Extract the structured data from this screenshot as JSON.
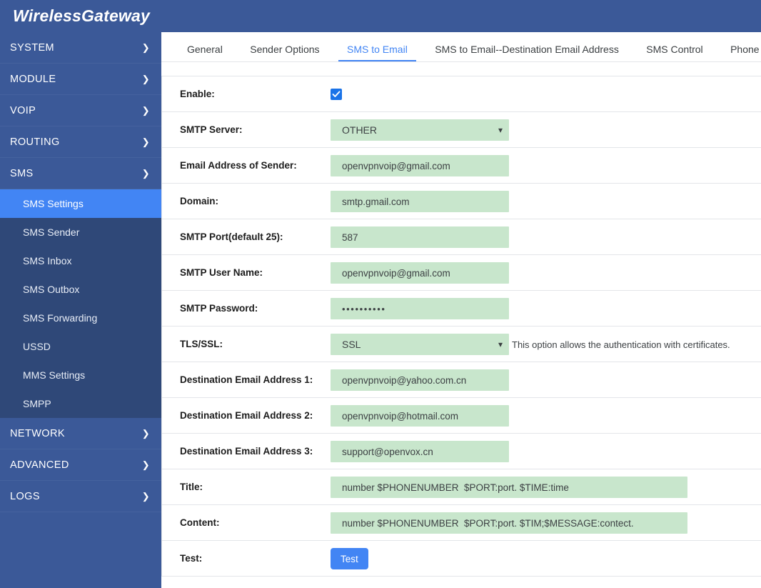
{
  "header": {
    "brand": "WirelessGateway"
  },
  "sidebar": {
    "items": [
      {
        "label": "SYSTEM",
        "icon": "chevron-right-icon",
        "expanded": false
      },
      {
        "label": "MODULE",
        "icon": "chevron-right-icon",
        "expanded": false
      },
      {
        "label": "VOIP",
        "icon": "chevron-right-icon",
        "expanded": false
      },
      {
        "label": "ROUTING",
        "icon": "chevron-right-icon",
        "expanded": false
      },
      {
        "label": "SMS",
        "icon": "chevron-down-icon",
        "expanded": true
      },
      {
        "label": "NETWORK",
        "icon": "chevron-right-icon",
        "expanded": false
      },
      {
        "label": "ADVANCED",
        "icon": "chevron-right-icon",
        "expanded": false
      },
      {
        "label": "LOGS",
        "icon": "chevron-right-icon",
        "expanded": false
      }
    ],
    "sms_submenu": [
      {
        "label": "SMS Settings",
        "active": true
      },
      {
        "label": "SMS Sender",
        "active": false
      },
      {
        "label": "SMS Inbox",
        "active": false
      },
      {
        "label": "SMS Outbox",
        "active": false
      },
      {
        "label": "SMS Forwarding",
        "active": false
      },
      {
        "label": "USSD",
        "active": false
      },
      {
        "label": "MMS Settings",
        "active": false
      },
      {
        "label": "SMPP",
        "active": false
      }
    ],
    "active_color": "#4285f4",
    "bg_color": "#3b5998",
    "submenu_bg_color": "#2f4878"
  },
  "tabs": [
    {
      "label": "General",
      "active": false
    },
    {
      "label": "Sender Options",
      "active": false
    },
    {
      "label": "SMS to Email",
      "active": true
    },
    {
      "label": "SMS to Email--Destination Email Address",
      "active": false
    },
    {
      "label": "SMS Control",
      "active": false
    },
    {
      "label": "Phone Number Query",
      "active": false
    }
  ],
  "form": {
    "enable": {
      "label": "Enable:",
      "checked": true
    },
    "smtp_server": {
      "label": "SMTP Server:",
      "value": "OTHER"
    },
    "sender_email": {
      "label": "Email Address of Sender:",
      "value": "openvpnvoip@gmail.com"
    },
    "domain": {
      "label": "Domain:",
      "value": "smtp.gmail.com"
    },
    "smtp_port": {
      "label": "SMTP Port(default 25):",
      "value": "587"
    },
    "smtp_user": {
      "label": "SMTP User Name:",
      "value": "openvpnvoip@gmail.com"
    },
    "smtp_password": {
      "label": "SMTP Password:",
      "value": "••••••••••"
    },
    "tls_ssl": {
      "label": "TLS/SSL:",
      "value": "SSL",
      "hint": "This option allows the authentication with certificates."
    },
    "dest_email_1": {
      "label": "Destination Email Address 1:",
      "value": "openvpnvoip@yahoo.com.cn"
    },
    "dest_email_2": {
      "label": "Destination Email Address 2:",
      "value": "openvpnvoip@hotmail.com"
    },
    "dest_email_3": {
      "label": "Destination Email Address 3:",
      "value": "support@openvox.cn"
    },
    "title": {
      "label": "Title:",
      "value": "number $PHONENUMBER  $PORT:port. $TIME:time"
    },
    "content": {
      "label": "Content:",
      "value": "number $PHONENUMBER  $PORT:port. $TIM;$MESSAGE:contect."
    },
    "test": {
      "label": "Test:",
      "button_label": "Test"
    }
  },
  "colors": {
    "accent": "#4285f4",
    "header_bg": "#3b5998",
    "input_bg": "#c8e6cc",
    "checkbox": "#1a73e8"
  }
}
